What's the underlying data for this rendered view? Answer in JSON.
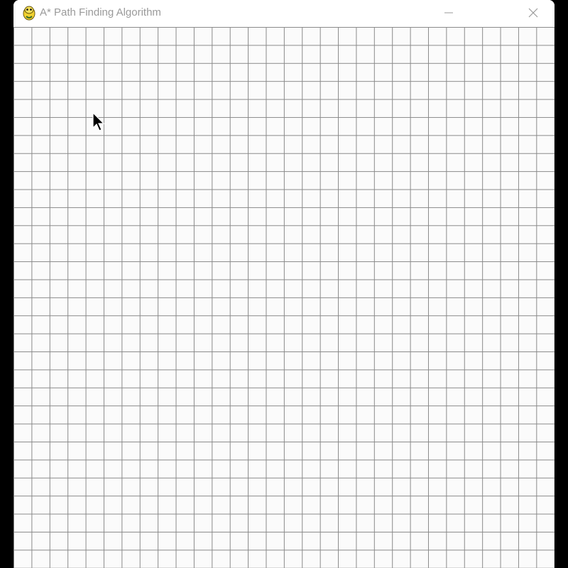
{
  "window": {
    "title": "A* Path Finding Algorithm",
    "icon": "pygame-snake-icon",
    "controls": {
      "minimize": "minimize-icon",
      "close": "close-icon"
    }
  },
  "grid": {
    "rows": 30,
    "cols": 30,
    "line_color": "#8a8a8a",
    "cell_color": "#fbfbfb"
  },
  "colors": {
    "desktop": "#000000",
    "titlebar": "#ffffff",
    "title_text": "#9a9a9a"
  }
}
